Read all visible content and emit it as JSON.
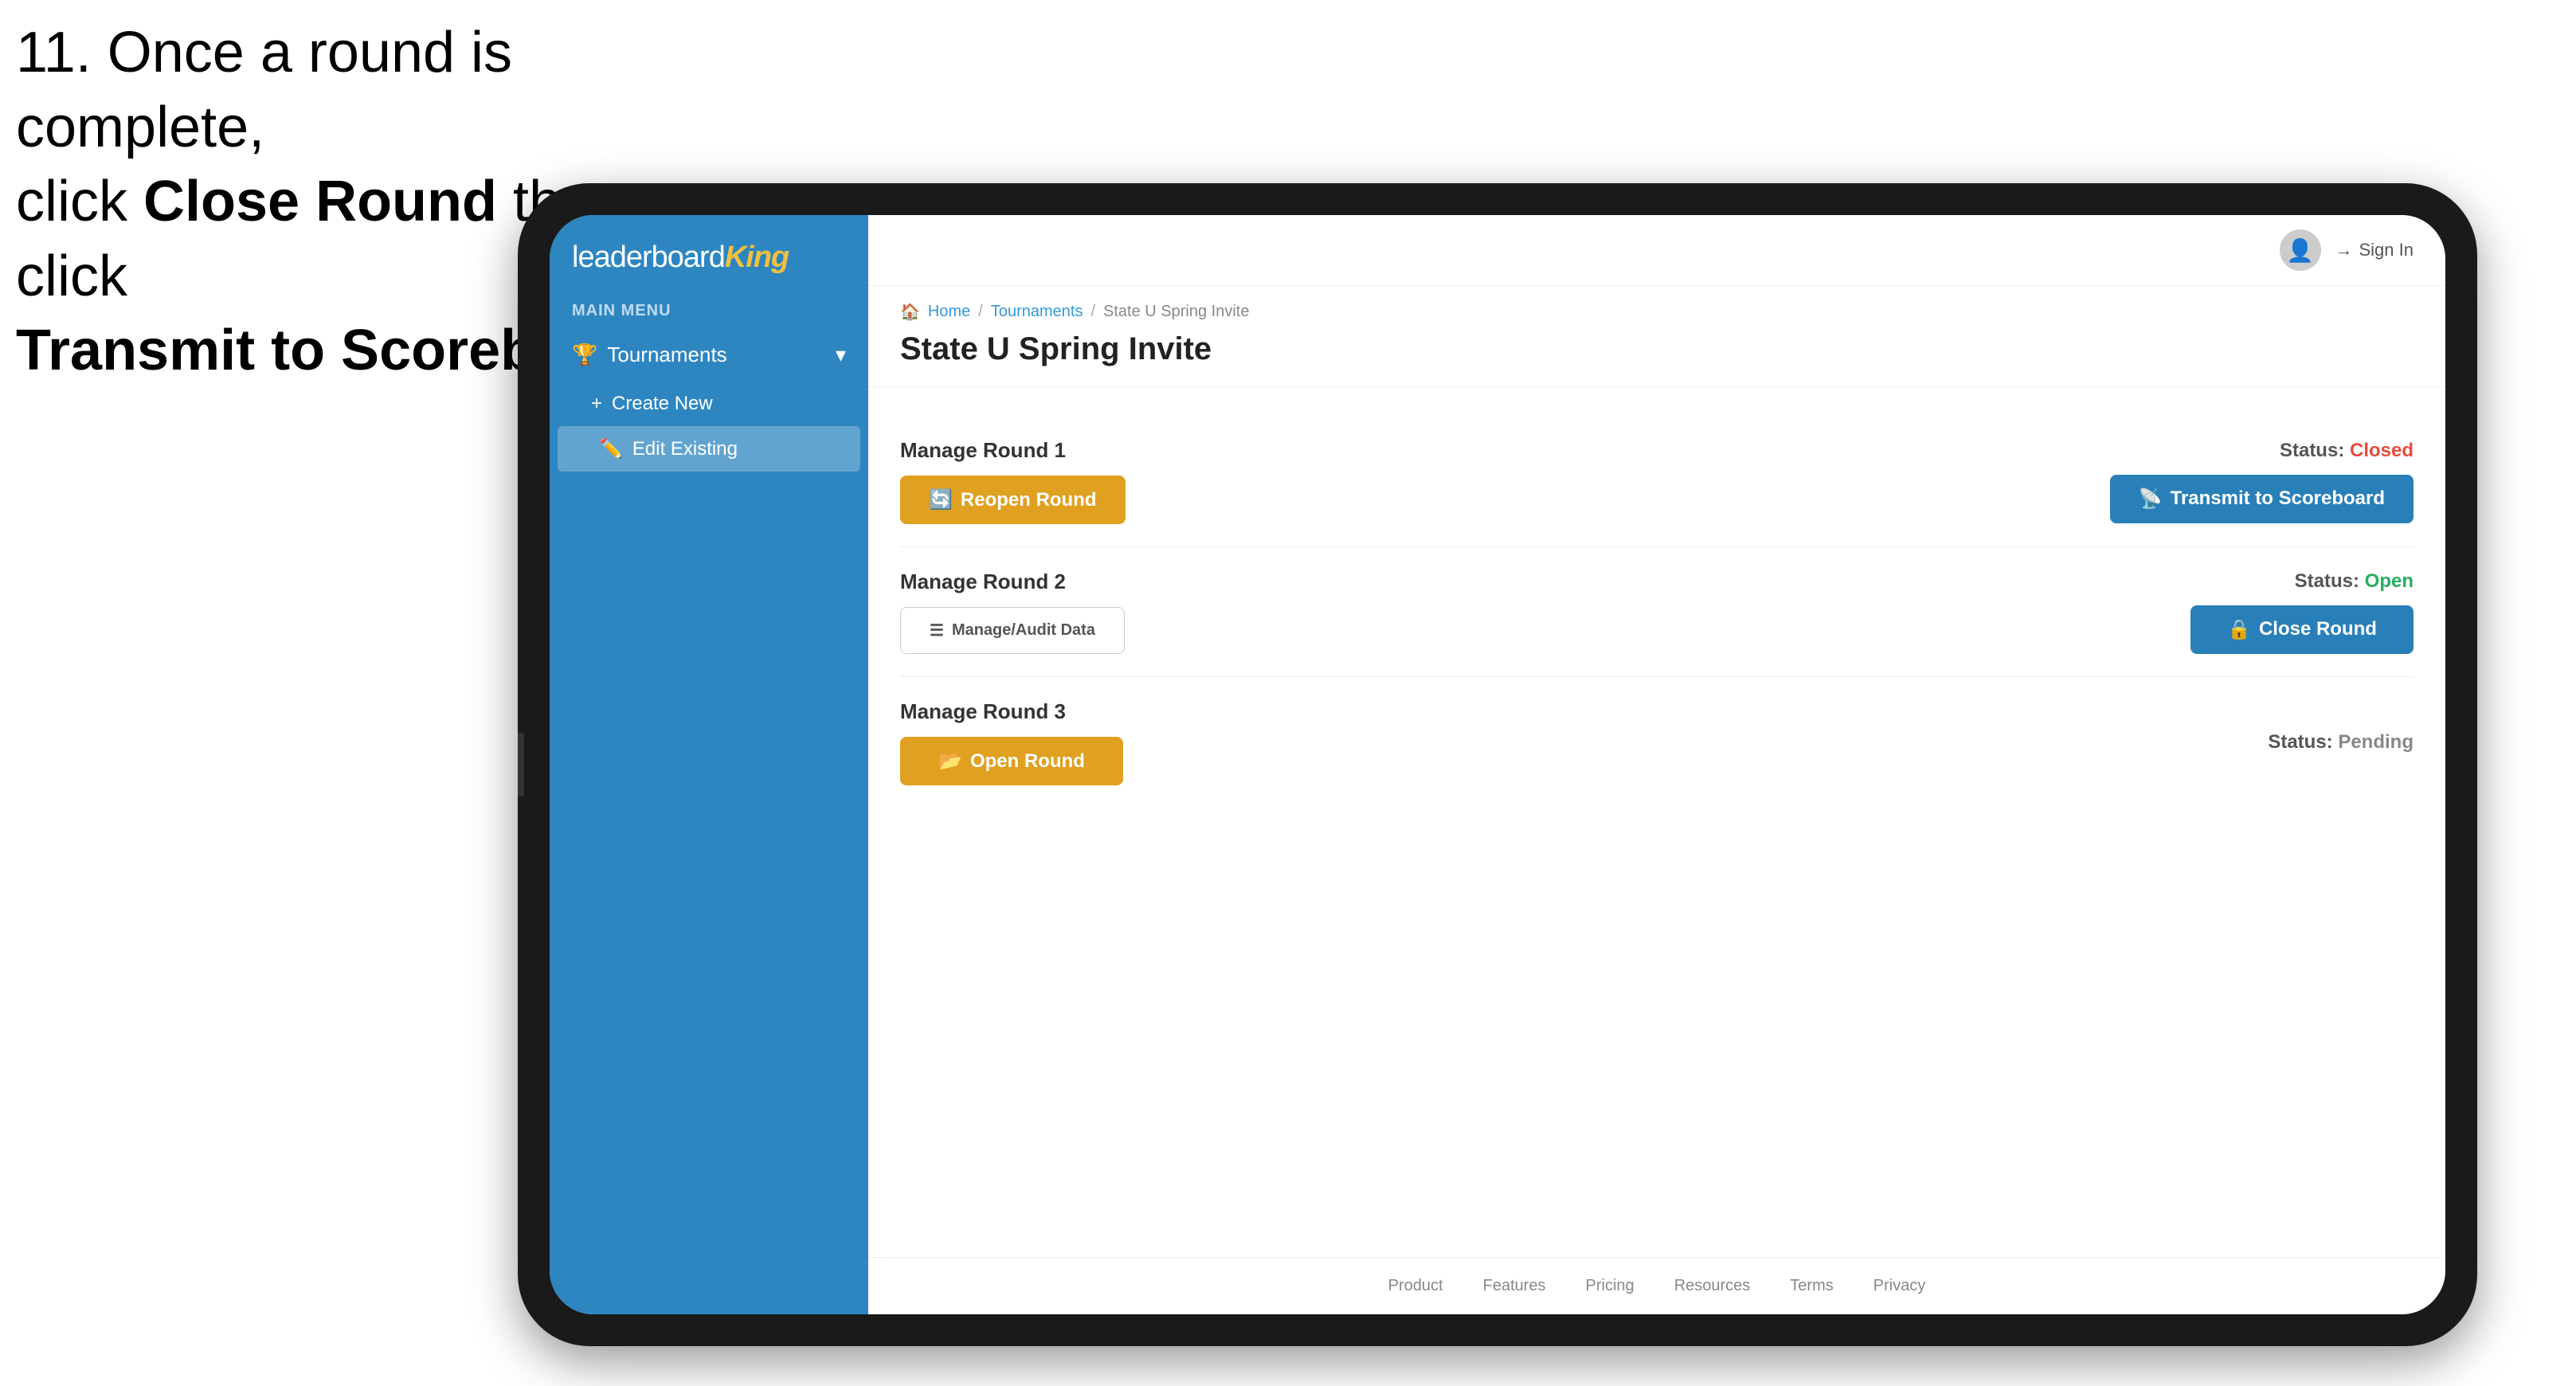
{
  "instruction": {
    "line1": "11. Once a round is complete,",
    "line2": "click ",
    "bold1": "Close Round",
    "line3": " then click",
    "bold2": "Transmit to Scoreboard."
  },
  "app": {
    "logo": {
      "prefix": "leaderboard",
      "suffix": "King"
    },
    "sidebar": {
      "menu_label": "MAIN MENU",
      "tournaments_label": "Tournaments",
      "create_new_label": "Create New",
      "edit_existing_label": "Edit Existing"
    },
    "topbar": {
      "sign_in": "Sign In"
    },
    "breadcrumb": {
      "home": "Home",
      "tournaments": "Tournaments",
      "current": "State U Spring Invite"
    },
    "page_title": "State U Spring Invite",
    "rounds": [
      {
        "title": "Manage Round 1",
        "status_label": "Status:",
        "status_value": "Closed",
        "status_class": "status-closed",
        "button_label": "Reopen Round",
        "button_class": "btn-amber",
        "button_icon": "🔄",
        "right_button_label": "Transmit to Scoreboard",
        "right_button_class": "btn-blue",
        "right_button_icon": "📡"
      },
      {
        "title": "Manage Round 2",
        "status_label": "Status:",
        "status_value": "Open",
        "status_class": "status-open",
        "audit_button_label": "Manage/Audit Data",
        "audit_button_class": "btn-outline",
        "audit_button_icon": "☰",
        "right_button_label": "Close Round",
        "right_button_class": "btn-blue",
        "right_button_icon": "🔒"
      },
      {
        "title": "Manage Round 3",
        "status_label": "Status:",
        "status_value": "Pending",
        "status_class": "status-pending",
        "button_label": "Open Round",
        "button_class": "btn-amber",
        "button_icon": "📂"
      }
    ],
    "footer": {
      "links": [
        "Product",
        "Features",
        "Pricing",
        "Resources",
        "Terms",
        "Privacy"
      ]
    }
  }
}
